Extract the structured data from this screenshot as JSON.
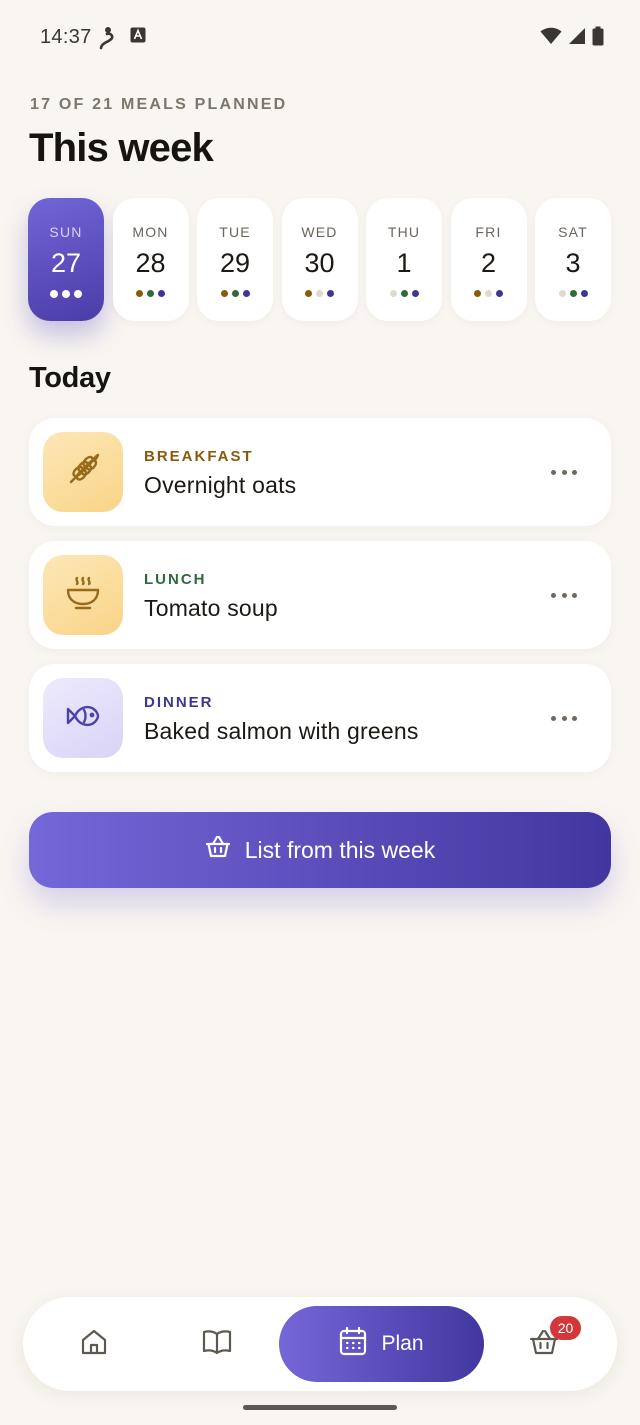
{
  "status_bar": {
    "time": "14:37",
    "icons": [
      "accessibility-icon",
      "keyboard-a-icon",
      "wifi-icon",
      "signal-icon",
      "battery-icon"
    ]
  },
  "header": {
    "meals_planned": "17 OF 21 MEALS PLANNED",
    "title": "This week"
  },
  "meal_colors": {
    "breakfast": "#8a5a0c",
    "lunch": "#2e6a3a",
    "dinner": "#3d3692",
    "empty": "#e0d9cf"
  },
  "week": [
    {
      "name": "SUN",
      "num": "27",
      "active": true,
      "dots": [
        "w",
        "w",
        "w"
      ]
    },
    {
      "name": "MON",
      "num": "28",
      "dots": [
        "breakfast",
        "lunch",
        "dinner"
      ]
    },
    {
      "name": "TUE",
      "num": "29",
      "dots": [
        "breakfast",
        "lunch",
        "dinner"
      ]
    },
    {
      "name": "WED",
      "num": "30",
      "dots": [
        "breakfast",
        "empty",
        "dinner"
      ]
    },
    {
      "name": "THU",
      "num": "1",
      "dots": [
        "empty",
        "lunch",
        "dinner"
      ]
    },
    {
      "name": "FRI",
      "num": "2",
      "dots": [
        "breakfast",
        "empty",
        "dinner"
      ]
    },
    {
      "name": "SAT",
      "num": "3",
      "dots": [
        "empty",
        "lunch",
        "dinner"
      ]
    }
  ],
  "today": {
    "title": "Today",
    "meals": [
      {
        "type": "BREAKFAST",
        "name": "Overnight oats",
        "icon": "wheat-icon",
        "type_color": "#8a5a0c"
      },
      {
        "type": "LUNCH",
        "name": "Tomato soup",
        "icon": "soup-bowl-icon",
        "type_color": "#2e6a3a"
      },
      {
        "type": "DINNER",
        "name": "Baked salmon with greens",
        "icon": "fish-icon",
        "type_color": "#3d3692"
      }
    ]
  },
  "cta": {
    "label": "List from this week",
    "icon": "basket-icon"
  },
  "nav": {
    "items": [
      "home-icon",
      "book-icon",
      "calendar-icon",
      "basket-icon"
    ],
    "plan_label": "Plan",
    "basket_badge": "20"
  },
  "colors": {
    "accent": "#5a4dc4",
    "background": "#f9f6f1",
    "badge": "#d4373b"
  }
}
